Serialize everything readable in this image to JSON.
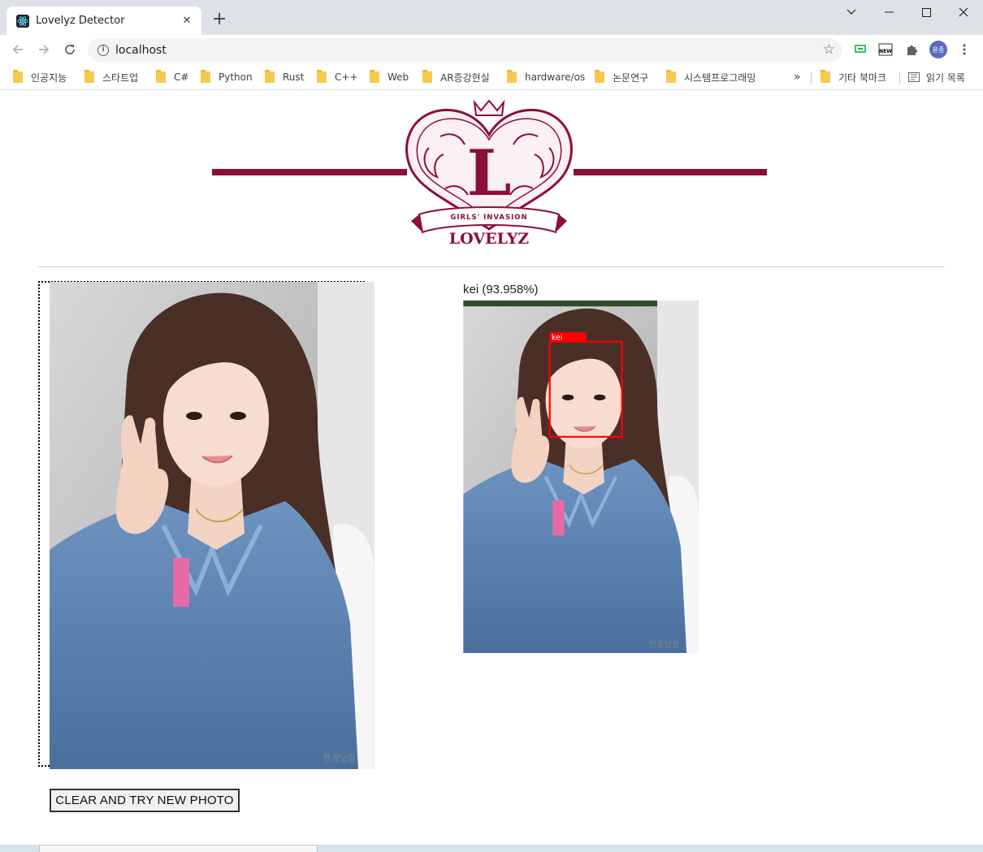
{
  "browser": {
    "tab_title": "Lovelyz Detector",
    "url": "localhost",
    "profile_initials": "윤종",
    "more_bookmarks": "»",
    "new_badge": "NEW"
  },
  "bookmarks": [
    {
      "label": "인공지능"
    },
    {
      "label": "스타트업"
    },
    {
      "label": "C#"
    },
    {
      "label": "Python"
    },
    {
      "label": "Rust"
    },
    {
      "label": "C++"
    },
    {
      "label": "Web"
    },
    {
      "label": "AR증강현실"
    },
    {
      "label": "hardware/os"
    },
    {
      "label": "논문연구"
    },
    {
      "label": "시스템프로그래밍"
    }
  ],
  "other_bookmarks": "기타 북마크",
  "reading_list": "읽기 목록",
  "logo": {
    "subtitle": "GIRLS' INVASION",
    "name": "LOVELYZ",
    "letter": "L",
    "color": "#8d0e3a"
  },
  "result": {
    "label": "kei (93.958%)",
    "box_label": "kei",
    "box_color": "#ff0000"
  },
  "watermark": "한경닷컴",
  "actions": {
    "clear_label": "CLEAR AND TRY NEW PHOTO"
  }
}
